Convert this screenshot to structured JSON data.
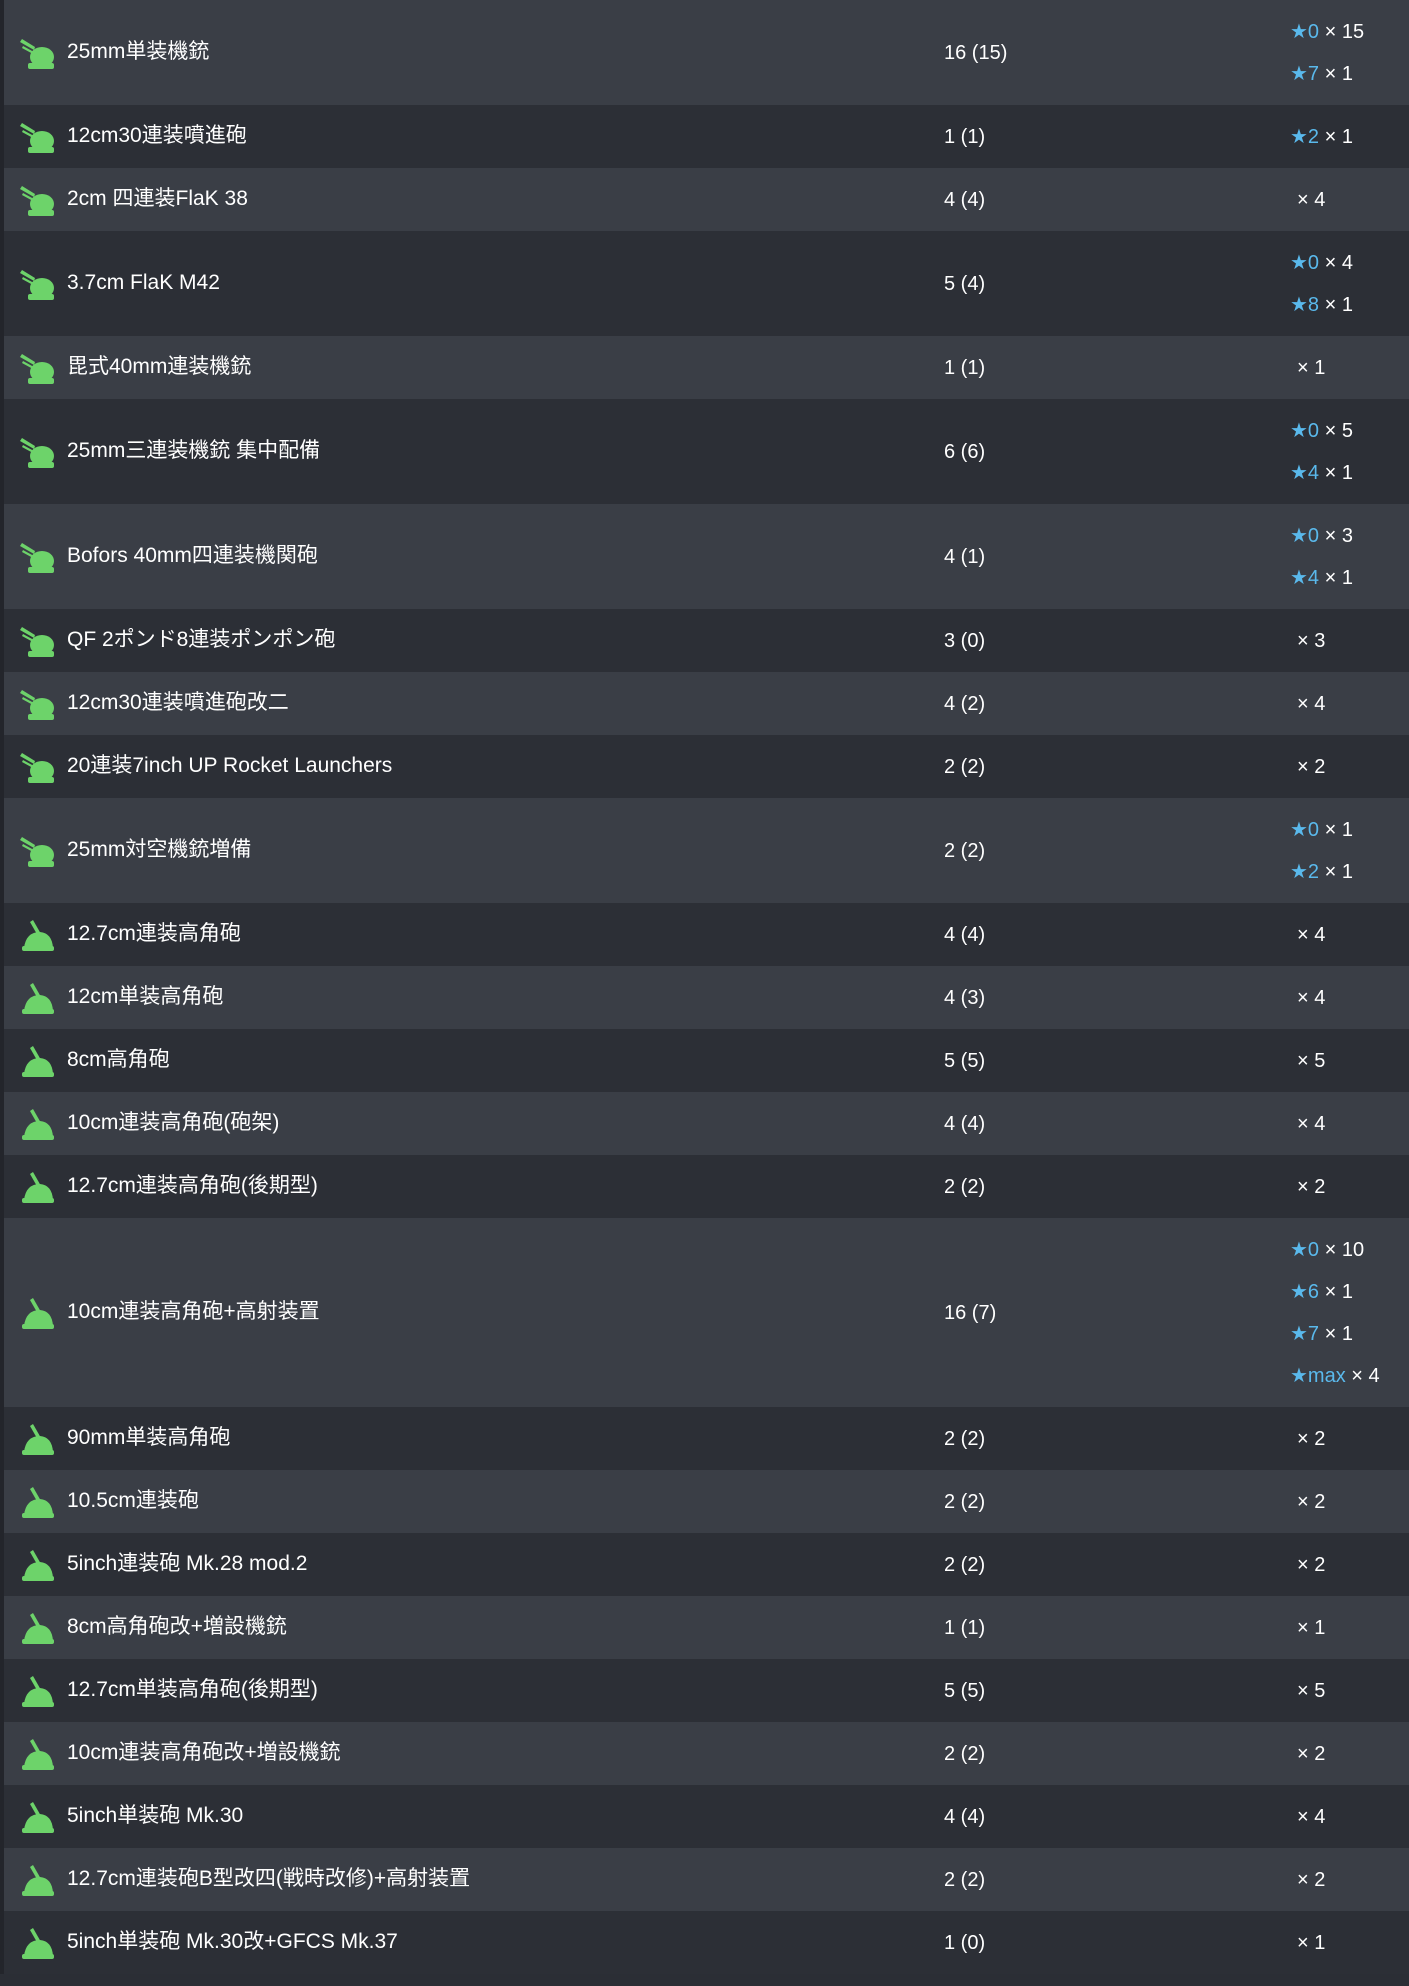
{
  "colors": {
    "row_odd": "#3a3e46",
    "row_even": "#2c2f36",
    "text": "#ffffff",
    "star": "#5ab9ec",
    "icon_green": "#6dd36a"
  },
  "rows": [
    {
      "icon": "aa-machine-gun-icon",
      "name": "25mm単装機銃",
      "count": "16 (15)",
      "improvements": [
        {
          "star": "★0",
          "qty": " × 15"
        },
        {
          "star": "★7",
          "qty": " × 1"
        }
      ]
    },
    {
      "icon": "aa-machine-gun-icon",
      "name": "12cm30連装噴進砲",
      "count": "1 (1)",
      "improvements": [
        {
          "star": "★2",
          "qty": " × 1"
        }
      ]
    },
    {
      "icon": "aa-machine-gun-icon",
      "name": "2cm 四連装FlaK 38",
      "count": "4 (4)",
      "improvements": [
        {
          "star": "",
          "qty": "× 4"
        }
      ]
    },
    {
      "icon": "aa-machine-gun-icon",
      "name": "3.7cm FlaK M42",
      "count": "5 (4)",
      "improvements": [
        {
          "star": "★0",
          "qty": " × 4"
        },
        {
          "star": "★8",
          "qty": " × 1"
        }
      ]
    },
    {
      "icon": "aa-machine-gun-icon",
      "name": "毘式40mm連装機銃",
      "count": "1 (1)",
      "improvements": [
        {
          "star": "",
          "qty": "× 1"
        }
      ]
    },
    {
      "icon": "aa-machine-gun-icon",
      "name": "25mm三連装機銃 集中配備",
      "count": "6 (6)",
      "improvements": [
        {
          "star": "★0",
          "qty": " × 5"
        },
        {
          "star": "★4",
          "qty": " × 1"
        }
      ]
    },
    {
      "icon": "aa-machine-gun-icon",
      "name": "Bofors 40mm四連装機関砲",
      "count": "4 (1)",
      "improvements": [
        {
          "star": "★0",
          "qty": " × 3"
        },
        {
          "star": "★4",
          "qty": " × 1"
        }
      ]
    },
    {
      "icon": "aa-machine-gun-icon",
      "name": "QF 2ポンド8連装ポンポン砲",
      "count": "3 (0)",
      "improvements": [
        {
          "star": "",
          "qty": "× 3"
        }
      ]
    },
    {
      "icon": "aa-machine-gun-icon",
      "name": "12cm30連装噴進砲改二",
      "count": "4 (2)",
      "improvements": [
        {
          "star": "",
          "qty": "× 4"
        }
      ]
    },
    {
      "icon": "aa-machine-gun-icon",
      "name": "20連装7inch UP Rocket Launchers",
      "count": "2 (2)",
      "improvements": [
        {
          "star": "",
          "qty": "× 2"
        }
      ]
    },
    {
      "icon": "aa-machine-gun-icon",
      "name": "25mm対空機銃増備",
      "count": "2 (2)",
      "improvements": [
        {
          "star": "★0",
          "qty": " × 1"
        },
        {
          "star": "★2",
          "qty": " × 1"
        }
      ]
    },
    {
      "icon": "high-angle-gun-icon",
      "name": "12.7cm連装高角砲",
      "count": "4 (4)",
      "improvements": [
        {
          "star": "",
          "qty": "× 4"
        }
      ]
    },
    {
      "icon": "high-angle-gun-icon",
      "name": "12cm単装高角砲",
      "count": "4 (3)",
      "improvements": [
        {
          "star": "",
          "qty": "× 4"
        }
      ]
    },
    {
      "icon": "high-angle-gun-icon",
      "name": "8cm高角砲",
      "count": "5 (5)",
      "improvements": [
        {
          "star": "",
          "qty": "× 5"
        }
      ]
    },
    {
      "icon": "high-angle-gun-icon",
      "name": "10cm連装高角砲(砲架)",
      "count": "4 (4)",
      "improvements": [
        {
          "star": "",
          "qty": "× 4"
        }
      ]
    },
    {
      "icon": "high-angle-gun-icon",
      "name": "12.7cm連装高角砲(後期型)",
      "count": "2 (2)",
      "improvements": [
        {
          "star": "",
          "qty": "× 2"
        }
      ]
    },
    {
      "icon": "high-angle-gun-icon",
      "name": "10cm連装高角砲+高射装置",
      "count": "16 (7)",
      "improvements": [
        {
          "star": "★0",
          "qty": " × 10"
        },
        {
          "star": "★6",
          "qty": " × 1"
        },
        {
          "star": "★7",
          "qty": " × 1"
        },
        {
          "star": "★max",
          "qty": " × 4"
        }
      ]
    },
    {
      "icon": "high-angle-gun-icon",
      "name": "90mm単装高角砲",
      "count": "2 (2)",
      "improvements": [
        {
          "star": "",
          "qty": "× 2"
        }
      ]
    },
    {
      "icon": "high-angle-gun-icon",
      "name": "10.5cm連装砲",
      "count": "2 (2)",
      "improvements": [
        {
          "star": "",
          "qty": "× 2"
        }
      ]
    },
    {
      "icon": "high-angle-gun-icon",
      "name": "5inch連装砲 Mk.28 mod.2",
      "count": "2 (2)",
      "improvements": [
        {
          "star": "",
          "qty": "× 2"
        }
      ]
    },
    {
      "icon": "high-angle-gun-icon",
      "name": "8cm高角砲改+増設機銃",
      "count": "1 (1)",
      "improvements": [
        {
          "star": "",
          "qty": "× 1"
        }
      ]
    },
    {
      "icon": "high-angle-gun-icon",
      "name": "12.7cm単装高角砲(後期型)",
      "count": "5 (5)",
      "improvements": [
        {
          "star": "",
          "qty": "× 5"
        }
      ]
    },
    {
      "icon": "high-angle-gun-icon",
      "name": "10cm連装高角砲改+増設機銃",
      "count": "2 (2)",
      "improvements": [
        {
          "star": "",
          "qty": "× 2"
        }
      ]
    },
    {
      "icon": "high-angle-gun-icon",
      "name": "5inch単装砲 Mk.30",
      "count": "4 (4)",
      "improvements": [
        {
          "star": "",
          "qty": "× 4"
        }
      ]
    },
    {
      "icon": "high-angle-gun-icon",
      "name": "12.7cm連装砲B型改四(戦時改修)+高射装置",
      "count": "2 (2)",
      "improvements": [
        {
          "star": "",
          "qty": "× 2"
        }
      ]
    },
    {
      "icon": "high-angle-gun-icon",
      "name": "5inch単装砲 Mk.30改+GFCS Mk.37",
      "count": "1 (0)",
      "improvements": [
        {
          "star": "",
          "qty": "× 1"
        }
      ]
    }
  ]
}
